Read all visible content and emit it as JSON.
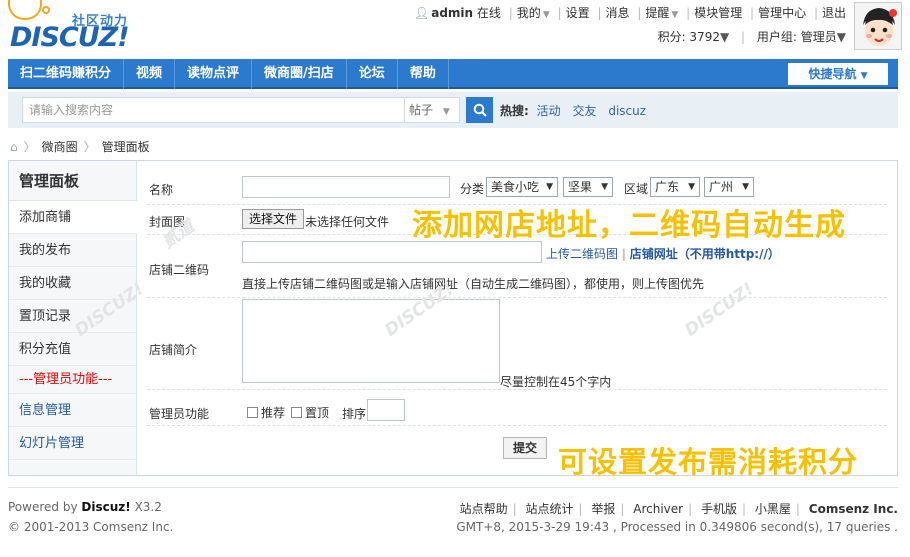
{
  "logo": {
    "cn": "社区动力",
    "en": "DISCUZ!"
  },
  "user_menu": {
    "username": "admin",
    "status": "在线",
    "items": [
      "我的",
      "设置",
      "消息",
      "提醒",
      "模块管理",
      "管理中心",
      "退出"
    ],
    "points_label": "积分: 3792",
    "group_label": "用户组: 管理员"
  },
  "nav": {
    "items": [
      "扫二维码赚积分",
      "视频",
      "读物点评",
      "微商圈/扫店",
      "论坛",
      "帮助"
    ],
    "quick_nav": "快捷导航"
  },
  "search": {
    "placeholder": "请输入搜索内容",
    "type": "帖子",
    "hot_label": "热搜:",
    "hot_tags": [
      "活动",
      "交友",
      "discuz"
    ]
  },
  "breadcrumb": [
    "微商圈",
    "管理面板"
  ],
  "sidebar": {
    "title": "管理面板",
    "items": [
      "添加商铺",
      "我的发布",
      "我的收藏",
      "置顶记录",
      "积分充值"
    ],
    "admin_header": "---管理员功能---",
    "admin_items": [
      "信息管理",
      "幻灯片管理"
    ]
  },
  "form": {
    "name_label": "名称",
    "category_label": "分类",
    "category_1": "美食小吃",
    "category_2": "坚果",
    "region_label": "区域",
    "region_1": "广东",
    "region_2": "广州",
    "cover_label": "封面图",
    "choose_file": "选择文件",
    "no_file": "未选择任何文件",
    "qr_label": "店铺二维码",
    "upload_qr": "上传二维码图",
    "shop_url": "店铺网址（不用带http://）",
    "qr_hint": "直接上传店铺二维码图或是输入店铺网址（自动生成二维码图），都使用，则上传图优先",
    "intro_label": "店铺简介",
    "intro_hint": "尽量控制在45个字内",
    "admin_label": "管理员功能",
    "recommend": "推荐",
    "sticky": "置顶",
    "sort_label": "排序",
    "submit": "提交"
  },
  "promo": {
    "top": "添加网店地址，二维码自动生成",
    "bottom": "可设置发布需消耗积分"
  },
  "footer": {
    "powered": "Powered by",
    "brand": "Discuz!",
    "version": "X3.2",
    "copyright": "© 2001-2013 Comsenz Inc.",
    "links": [
      "站点帮助",
      "站点统计",
      "举报",
      "Archiver",
      "手机版",
      "小黑屋"
    ],
    "company": "Comsenz Inc.",
    "stats": "GMT+8, 2015-3-29 19:43 , Processed in 0.349806 second(s), 17 queries ."
  }
}
